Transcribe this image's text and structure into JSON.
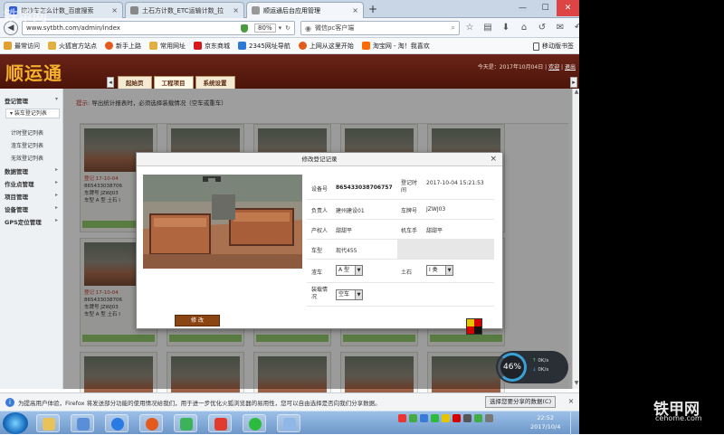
{
  "browser": {
    "tabs": [
      {
        "label": "挖沙车怎么计数_百度搜索",
        "active": false
      },
      {
        "label": "土石方计数_ETC运输计数_拉",
        "active": false
      },
      {
        "label": "顺运通后台应用管理",
        "active": true
      }
    ],
    "new_tab": "+",
    "url": "www.sytbth.com/admin/index",
    "zoom": "80%",
    "search_text": "微信pc客户端",
    "bookmarks": [
      {
        "label": "最常访问",
        "color": "#e0a030"
      },
      {
        "label": "火狐官方站点",
        "color": "#e35a1c"
      },
      {
        "label": "新手上路",
        "color": "#e35a1c"
      },
      {
        "label": "常用网址",
        "color": "#e0b040"
      },
      {
        "label": "京东商城",
        "color": "#d7191c"
      },
      {
        "label": "2345网址导航",
        "color": "#2d7ad6"
      },
      {
        "label": "上网从这里开始",
        "color": "#e35a1c"
      },
      {
        "label": "淘宝网 - 淘！我喜欢",
        "color": "#ff6a00"
      }
    ],
    "mobile_bookmarks": "移动版书签"
  },
  "app": {
    "logo": "顺运通",
    "date_text": "今天是：2017年10月04日",
    "user_link": "欢迎",
    "logout": "退出",
    "tabs": [
      "起始页",
      "工程项目",
      "系统设置"
    ],
    "active_tab": 1
  },
  "sidebar": {
    "groups": [
      {
        "label": "登记管理"
      },
      {
        "label": "数据管理"
      },
      {
        "label": "作业点管理"
      },
      {
        "label": "项目管理"
      },
      {
        "label": "设备管理"
      },
      {
        "label": "GPS定位管理"
      }
    ],
    "selected": "▾ 装车登记列表",
    "items": [
      "计时登记列表",
      "渣车登记列表",
      "无效登记列表"
    ]
  },
  "main": {
    "tip_prefix": "提示:",
    "tip_text": "导出统计报表时，必须选择装载情况（空车或重车）"
  },
  "cards": [
    {
      "line1": "登记 17-10-04",
      "line2": "865433038706",
      "line3": "车牌号 JZWJ03",
      "line4": "车型 A 型 土石 Ⅰ"
    },
    {
      "line1": "登记 17-10-04",
      "line2": "865433038706",
      "line3": "车牌号 JZWJ03",
      "line4": "车型 A 型 土石 Ⅰ"
    }
  ],
  "modal": {
    "title": "修改登记记录",
    "close": "×",
    "fields": {
      "device_label": "设备号",
      "device_value": "865433038706757",
      "regtime_label": "登记时间",
      "regtime_value": "2017-10-04 15:21:53",
      "owner_label": "负责人",
      "owner_value": "建州建设01",
      "plate_label": "车牌号",
      "plate_value": "JZWJ03",
      "property_label": "产权人",
      "property_value": "甜甜平",
      "driver_label": "机车手",
      "driver_value": "甜甜平",
      "model_label": "车型",
      "model_value": "现代455",
      "car_label": "渣车",
      "car_value": "A 型",
      "soil_label": "土石",
      "soil_value": "Ⅰ 类",
      "load_label": "装载情况",
      "load_value": "空车"
    },
    "submit": "修 改"
  },
  "speed_widget": {
    "percent": "46%",
    "up": "0K/s",
    "down": "0K/s"
  },
  "notification": {
    "message": "为提高用户体验，Firefox 将发送部分功能的使用情况给我们，用于进一步优化火狐浏览器的易用性，您可以自由选择是否向我们分享数据。",
    "button": "选择您要分享的数据(C)",
    "close": "×"
  },
  "taskbar": {
    "time": "22:52",
    "date": "2017/10/4"
  },
  "watermarks": {
    "top": "铁甲网",
    "bottom": "铁甲网",
    "bottom_url": "cehome.com"
  }
}
